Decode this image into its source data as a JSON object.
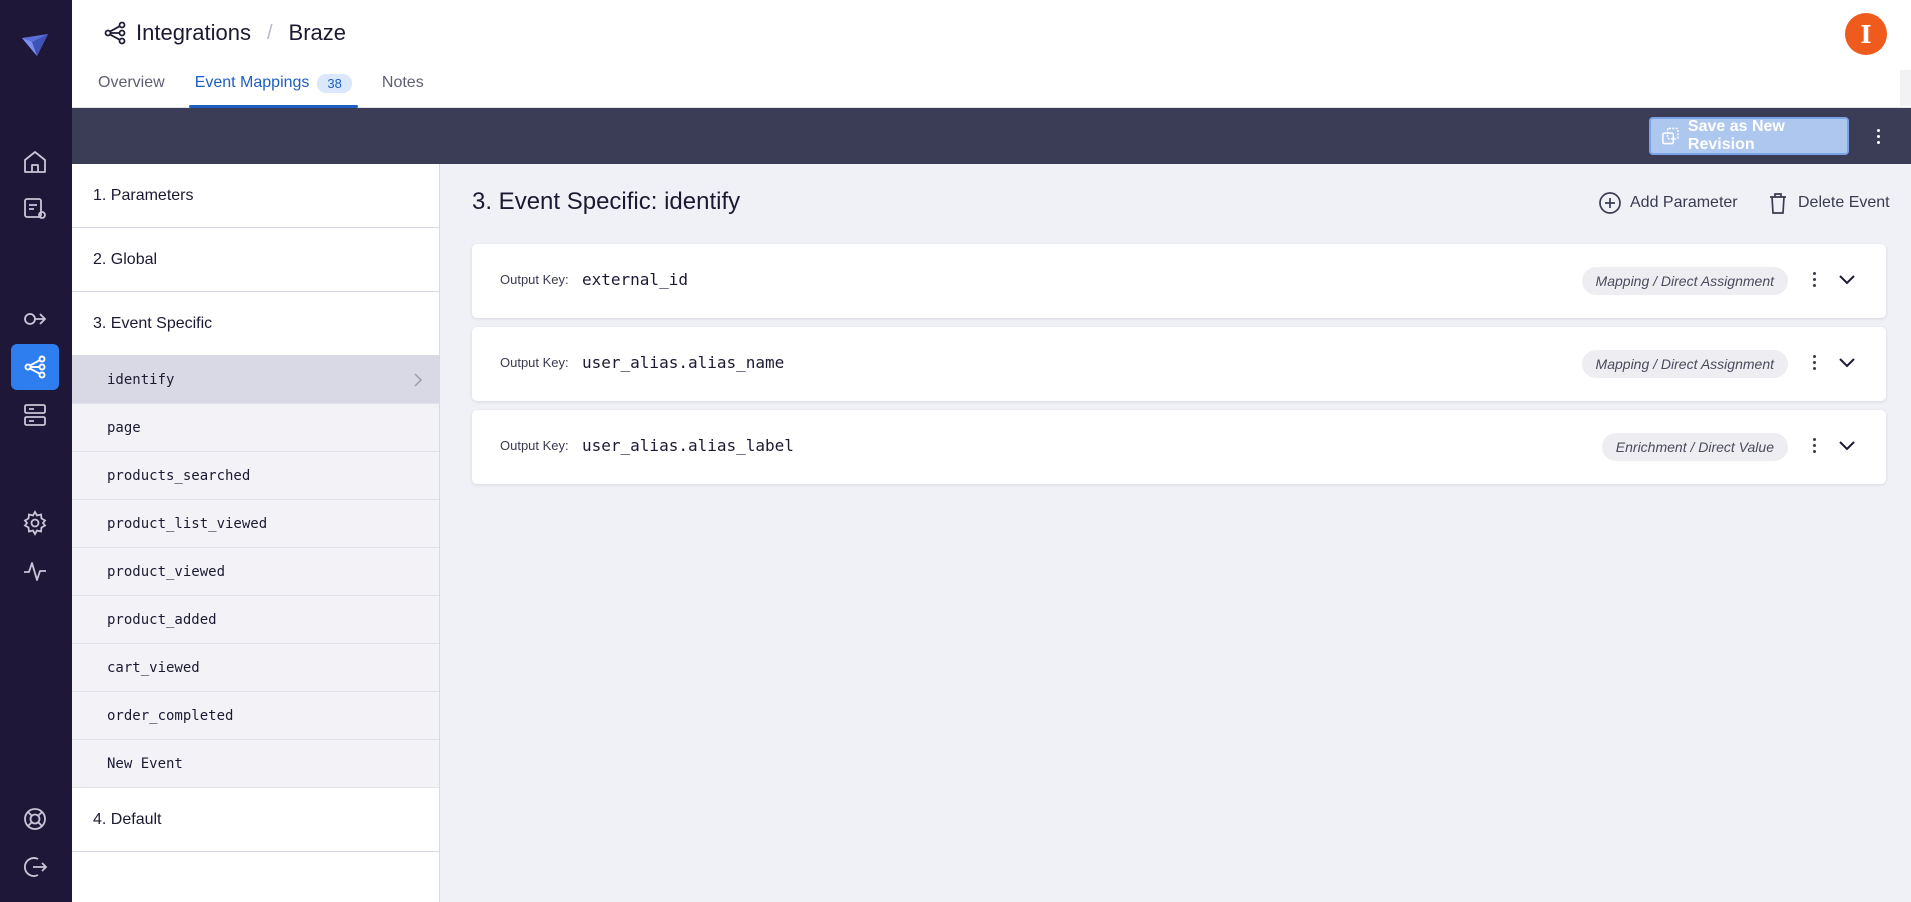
{
  "colors": {
    "rail_bg": "#1f1737",
    "accent": "#2f7ef0",
    "tab_active": "#1d5fbf",
    "toolbar_bg": "#3b3c55",
    "avatar_bg": "#ef5b1d"
  },
  "rail": {
    "logo": "brand-logo",
    "items": [
      {
        "icon": "home-icon"
      },
      {
        "icon": "catalog-edit-icon"
      },
      {
        "icon": "destination-icon"
      },
      {
        "icon": "integrations-icon",
        "active": true
      },
      {
        "icon": "database-icon"
      },
      {
        "icon": "settings-icon"
      },
      {
        "icon": "activity-icon"
      },
      {
        "icon": "help-icon"
      },
      {
        "icon": "logout-icon"
      }
    ]
  },
  "header": {
    "breadcrumb_root": "Integrations",
    "breadcrumb_sep": "/",
    "breadcrumb_current": "Braze",
    "avatar_initial": "I",
    "tabs": [
      {
        "label": "Overview"
      },
      {
        "label": "Event Mappings",
        "count": "38",
        "active": true
      },
      {
        "label": "Notes"
      }
    ]
  },
  "toolbar": {
    "save_label": "Save as New Revision"
  },
  "sidebar": {
    "sections": [
      {
        "label": "1. Parameters"
      },
      {
        "label": "2. Global"
      },
      {
        "label": "3. Event Specific"
      },
      {
        "label": "4. Default"
      }
    ],
    "events": [
      {
        "label": "identify",
        "active": true
      },
      {
        "label": "page"
      },
      {
        "label": "products_searched"
      },
      {
        "label": "product_list_viewed"
      },
      {
        "label": "product_viewed"
      },
      {
        "label": "product_added"
      },
      {
        "label": "cart_viewed"
      },
      {
        "label": "order_completed"
      },
      {
        "label": "New Event"
      }
    ]
  },
  "main": {
    "title": "3. Event Specific: identify",
    "add_parameter_label": "Add Parameter",
    "delete_event_label": "Delete Event",
    "output_key_label": "Output Key:",
    "parameters": [
      {
        "key": "external_id",
        "type": "Mapping / Direct Assignment"
      },
      {
        "key": "user_alias.alias_name",
        "type": "Mapping / Direct Assignment"
      },
      {
        "key": "user_alias.alias_label",
        "type": "Enrichment / Direct Value"
      }
    ]
  }
}
